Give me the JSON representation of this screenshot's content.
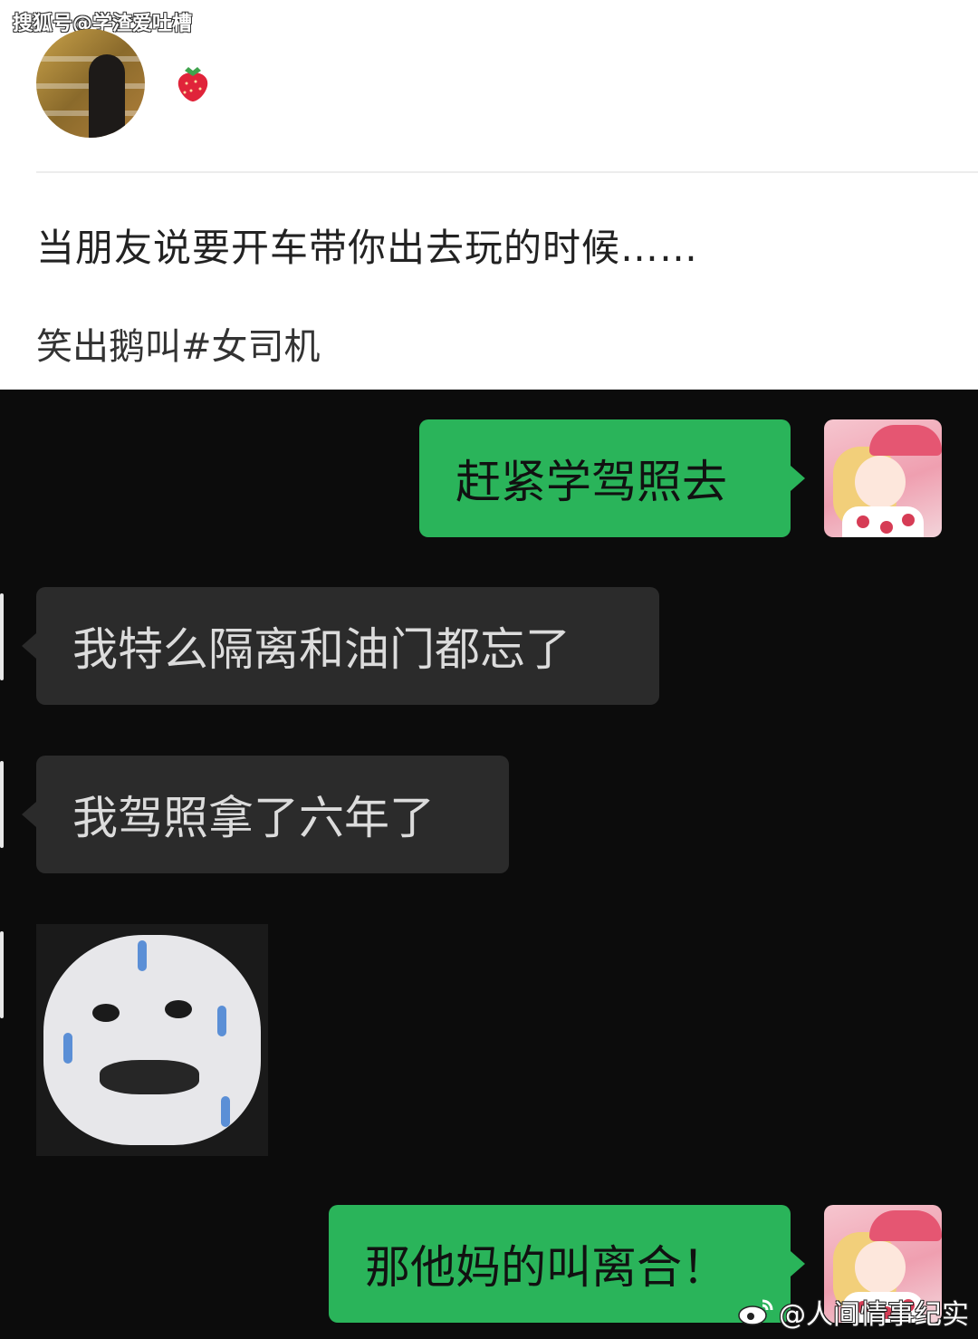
{
  "watermark_top": "搜狐号@学渣爱吐槽",
  "post": {
    "title": "当朋友说要开车带你出去玩的时候……",
    "tag": "笑出鹅叫#女司机"
  },
  "messages": [
    {
      "side": "right",
      "text": "赶紧学驾照去"
    },
    {
      "side": "left",
      "text": "我特么隔离和油门都忘了"
    },
    {
      "side": "left",
      "text": "我驾照拿了六年了"
    },
    {
      "side": "left",
      "type": "sticker"
    },
    {
      "side": "right",
      "text": "那他妈的叫离合！"
    }
  ],
  "watermark_bottom": "@人间情事纪实",
  "colors": {
    "my_bubble": "#2ab45a",
    "their_bubble": "#2b2b2b",
    "chat_bg": "#0c0c0c"
  },
  "icons": {
    "post_emoji": "strawberry-icon",
    "watermark_logo": "weibo-icon"
  }
}
